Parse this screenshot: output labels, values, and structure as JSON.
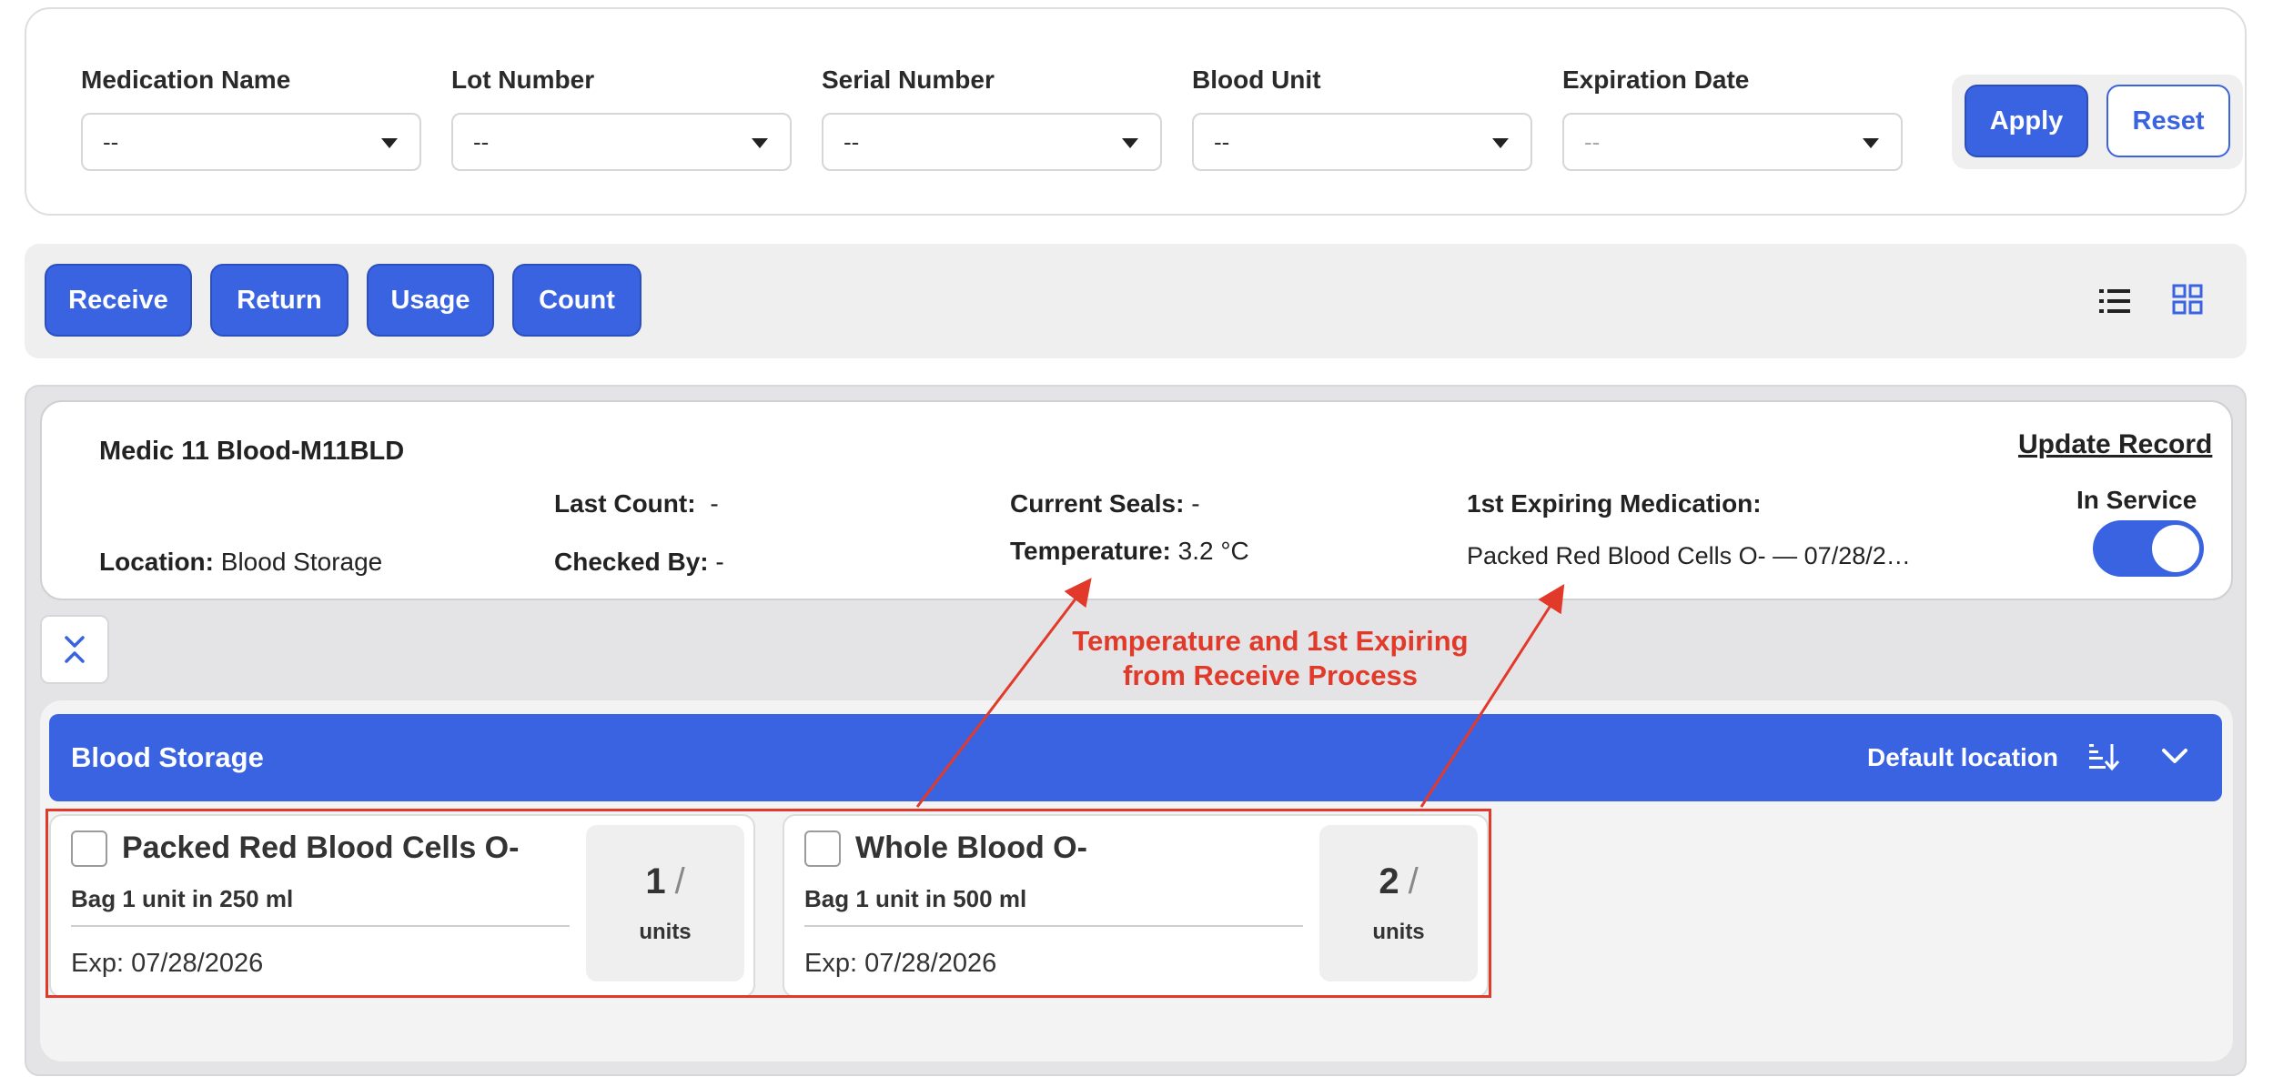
{
  "filters": [
    {
      "label": "Medication Name",
      "value": "--",
      "muted": false
    },
    {
      "label": "Lot Number",
      "value": "--",
      "muted": false
    },
    {
      "label": "Serial Number",
      "value": "--",
      "muted": false
    },
    {
      "label": "Blood Unit",
      "value": "--",
      "muted": false
    },
    {
      "label": "Expiration Date",
      "value": "--",
      "muted": true
    }
  ],
  "filter_actions": {
    "apply_label": "Apply",
    "reset_label": "Reset"
  },
  "toolbar": {
    "actions": [
      "Receive",
      "Return",
      "Usage",
      "Count"
    ],
    "view_icons": [
      "list-view-icon",
      "grid-view-icon"
    ]
  },
  "record": {
    "title": "Medic 11 Blood-M11BLD",
    "update_label": "Update Record",
    "location_label": "Location:",
    "location_value": "Blood Storage",
    "last_count_label": "Last Count:",
    "last_count_value": "-",
    "checked_by_label": "Checked By:",
    "checked_by_value": "-",
    "current_seals_label": "Current Seals:",
    "current_seals_value": "-",
    "temperature_label": "Temperature:",
    "temperature_value": "3.2 °C",
    "first_expiring_label": "1st Expiring Medication:",
    "first_expiring_value": "Packed Red Blood Cells O- — 07/28/2…",
    "status_label": "In Service",
    "in_service": true
  },
  "storage": {
    "title": "Blood Storage",
    "default_label": "Default location",
    "items": [
      {
        "name": "Packed Red Blood Cells O-",
        "description": "Bag 1 unit in 250 ml",
        "expiration": "Exp: 07/28/2026",
        "quantity": "1",
        "slash": "/",
        "unit": "units"
      },
      {
        "name": "Whole Blood O-",
        "description": "Bag 1 unit in 500 ml",
        "expiration": "Exp: 07/28/2026",
        "quantity": "2",
        "slash": "/",
        "unit": "units"
      }
    ]
  },
  "annotation": {
    "line1": "Temperature and 1st Expiring",
    "line2": "from Receive Process",
    "color": "#e23a2a"
  },
  "colors": {
    "accent": "#3a63e2",
    "annotation": "#e23a2a"
  }
}
